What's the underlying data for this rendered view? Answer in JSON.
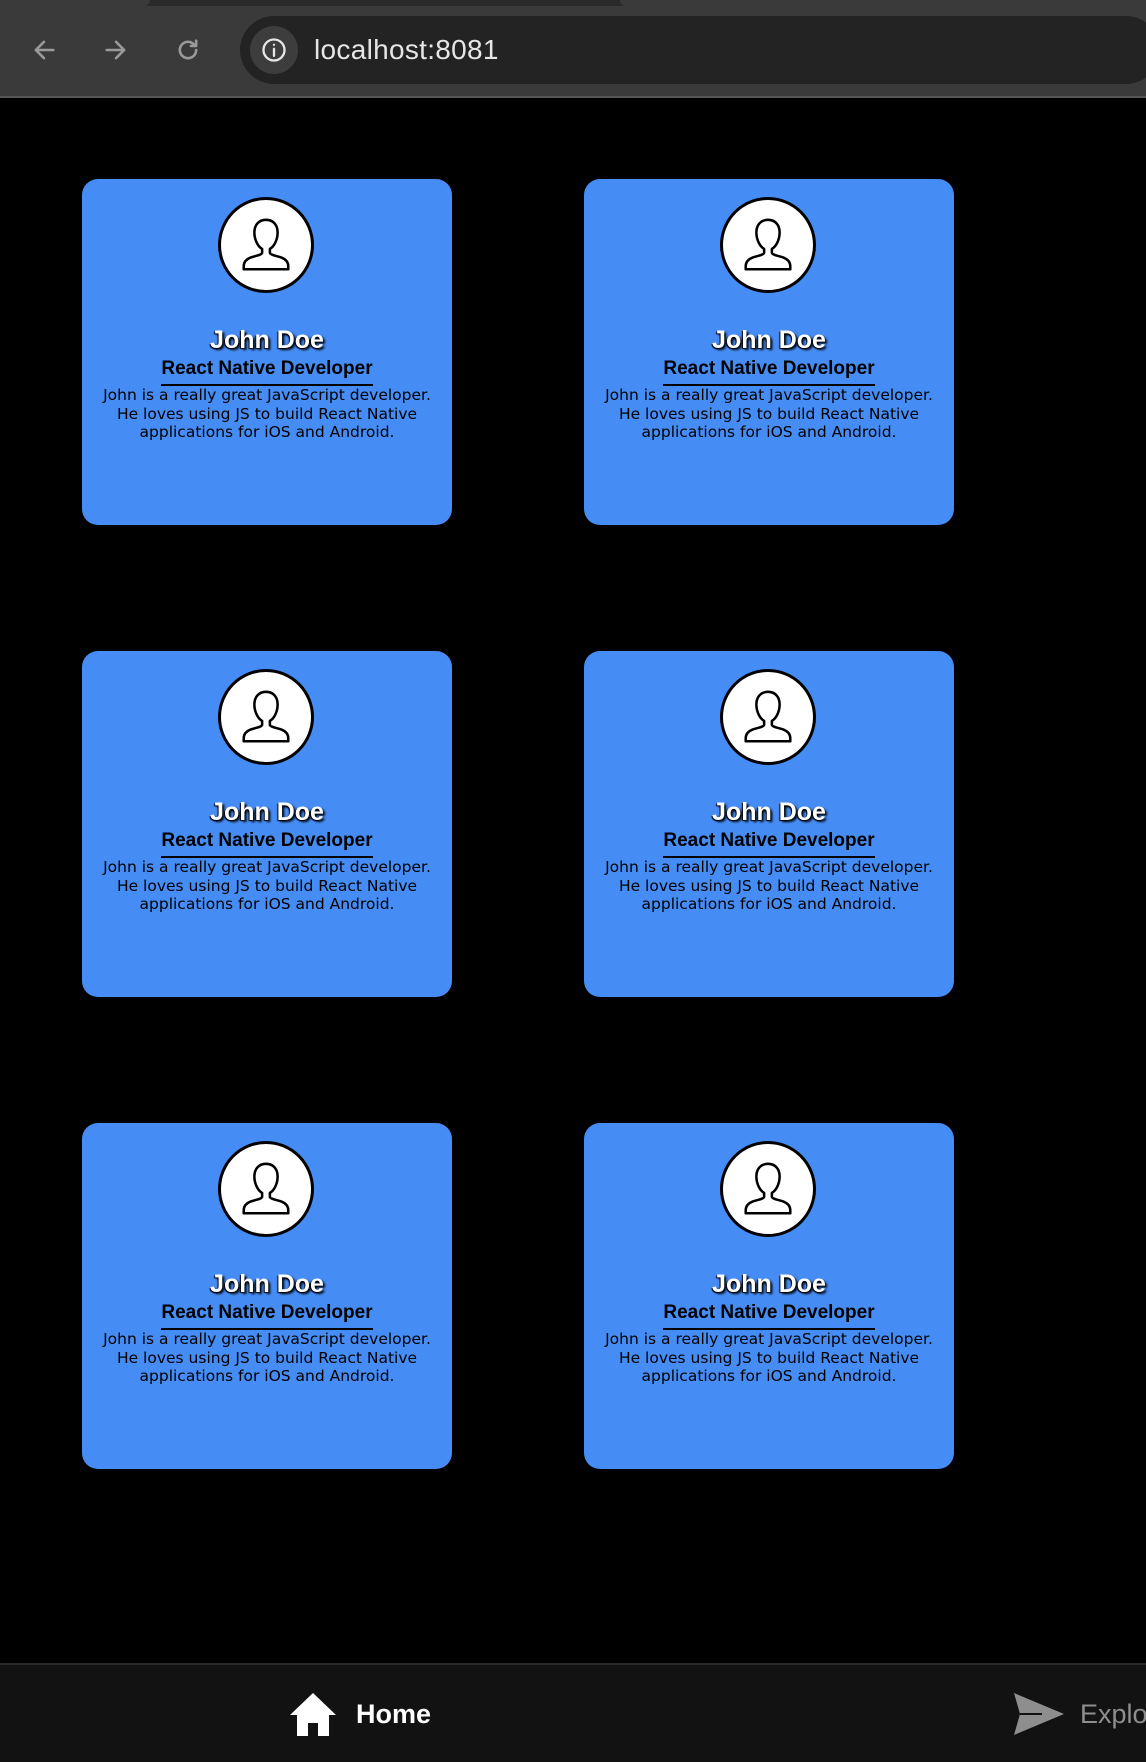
{
  "browser": {
    "url": "localhost:8081",
    "icons": {
      "back": "arrow-left-icon",
      "forward": "arrow-right-icon",
      "reload": "reload-icon",
      "info": "info-icon"
    }
  },
  "cards": [
    {
      "name": "John Doe",
      "role": "React Native Developer",
      "description": "John is a really great JavaScript developer. He loves using JS to build React Native applications for iOS and Android."
    },
    {
      "name": "John Doe",
      "role": "React Native Developer",
      "description": "John is a really great JavaScript developer. He loves using JS to build React Native applications for iOS and Android."
    },
    {
      "name": "John Doe",
      "role": "React Native Developer",
      "description": "John is a really great JavaScript developer. He loves using JS to build React Native applications for iOS and Android."
    },
    {
      "name": "John Doe",
      "role": "React Native Developer",
      "description": "John is a really great JavaScript developer. He loves using JS to build React Native applications for iOS and Android."
    },
    {
      "name": "John Doe",
      "role": "React Native Developer",
      "description": "John is a really great JavaScript developer. He loves using JS to build React Native applications for iOS and Android."
    },
    {
      "name": "John Doe",
      "role": "React Native Developer",
      "description": "John is a really great JavaScript developer. He loves using JS to build React Native applications for iOS and Android."
    }
  ],
  "tabbar": {
    "home_label": "Home",
    "explore_label": "Explo",
    "active_tab": "Home",
    "icons": {
      "home": "home-icon",
      "explore": "send-icon"
    }
  },
  "colors": {
    "card_background": "#468cf5",
    "page_background": "#000000",
    "tabbar_background": "#121212",
    "inactive_tab": "#8e8e8e"
  }
}
